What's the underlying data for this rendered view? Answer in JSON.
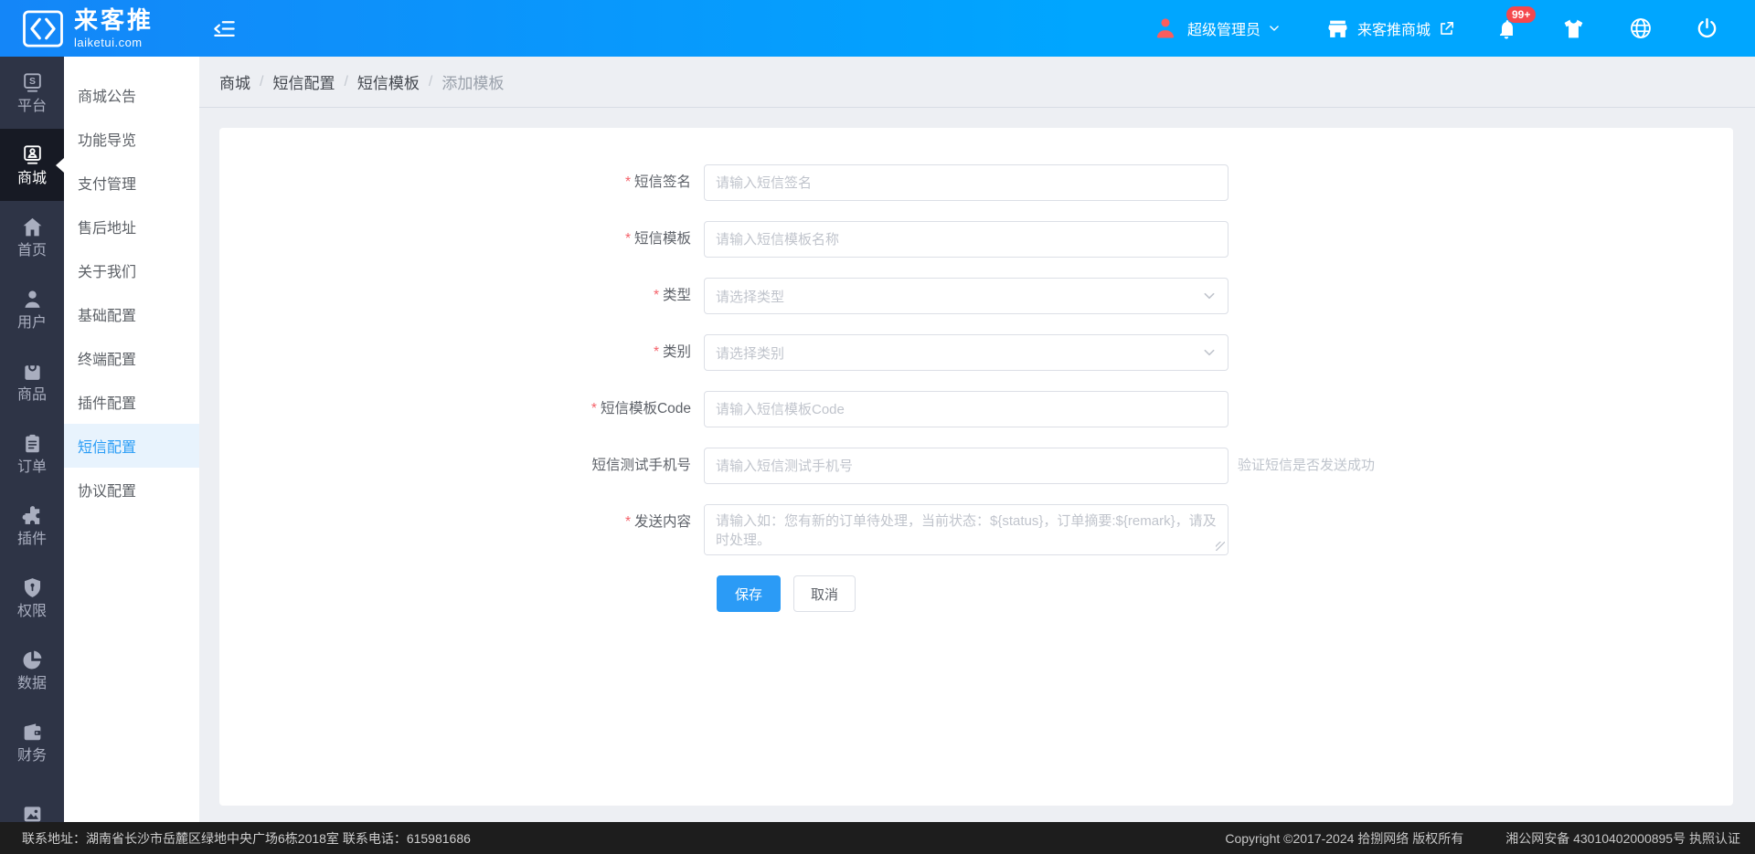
{
  "topbar": {
    "logo_title": "来客推",
    "logo_subtitle": "laiketui.com",
    "user_role": "超级管理员",
    "shop_link": "来客推商城",
    "notification_badge": "99+"
  },
  "rail": {
    "items": [
      {
        "name": "platform",
        "label": "平台",
        "icon": "platform-icon",
        "active": false
      },
      {
        "name": "mall",
        "label": "商城",
        "icon": "mall-icon",
        "active": true
      },
      {
        "name": "home",
        "label": "首页",
        "icon": "home-icon",
        "active": false
      },
      {
        "name": "user",
        "label": "用户",
        "icon": "user-icon",
        "active": false
      },
      {
        "name": "goods",
        "label": "商品",
        "icon": "goods-icon",
        "active": false
      },
      {
        "name": "order",
        "label": "订单",
        "icon": "order-icon",
        "active": false
      },
      {
        "name": "plugin",
        "label": "插件",
        "icon": "plugin-icon",
        "active": false
      },
      {
        "name": "permission",
        "label": "权限",
        "icon": "permission-icon",
        "active": false
      },
      {
        "name": "data",
        "label": "数据",
        "icon": "data-icon",
        "active": false
      },
      {
        "name": "finance",
        "label": "财务",
        "icon": "finance-icon",
        "active": false
      },
      {
        "name": "material",
        "label": "",
        "icon": "material-icon",
        "active": false
      }
    ]
  },
  "sidebar": {
    "items": [
      {
        "name": "notice",
        "label": "商城公告",
        "active": false
      },
      {
        "name": "guide",
        "label": "功能导览",
        "active": false
      },
      {
        "name": "payment",
        "label": "支付管理",
        "active": false
      },
      {
        "name": "aftersale",
        "label": "售后地址",
        "active": false
      },
      {
        "name": "about",
        "label": "关于我们",
        "active": false
      },
      {
        "name": "basic",
        "label": "基础配置",
        "active": false
      },
      {
        "name": "terminal",
        "label": "终端配置",
        "active": false
      },
      {
        "name": "plugin",
        "label": "插件配置",
        "active": false
      },
      {
        "name": "sms",
        "label": "短信配置",
        "active": true
      },
      {
        "name": "agreement",
        "label": "协议配置",
        "active": false
      }
    ]
  },
  "breadcrumb": {
    "separator": "/",
    "items": [
      "商城",
      "短信配置",
      "短信模板",
      "添加模板"
    ]
  },
  "form": {
    "fields": [
      {
        "name": "sms-signature",
        "label": "短信签名",
        "required": true,
        "type": "input",
        "placeholder": "请输入短信签名"
      },
      {
        "name": "sms-template",
        "label": "短信模板",
        "required": true,
        "type": "input",
        "placeholder": "请输入短信模板名称"
      },
      {
        "name": "type",
        "label": "类型",
        "required": true,
        "type": "select",
        "placeholder": "请选择类型"
      },
      {
        "name": "category",
        "label": "类别",
        "required": true,
        "type": "select",
        "placeholder": "请选择类别"
      },
      {
        "name": "sms-template-code",
        "label": "短信模板Code",
        "required": true,
        "type": "input",
        "placeholder": "请输入短信模板Code"
      },
      {
        "name": "sms-test-phone",
        "label": "短信测试手机号",
        "required": false,
        "type": "input",
        "placeholder": "请输入短信测试手机号",
        "hint": "验证短信是否发送成功"
      },
      {
        "name": "send-content",
        "label": "发送内容",
        "required": true,
        "type": "textarea",
        "placeholder": "请输入如：您有新的订单待处理，当前状态：${status}，订单摘要:${remark}，请及时处理。"
      }
    ],
    "save_label": "保存",
    "cancel_label": "取消"
  },
  "footer": {
    "contact": "联系地址：湖南省长沙市岳麓区绿地中央广场6栋2018室 联系电话：615981686",
    "copyright": "Copyright ©2017-2024 拾捌网络 版权所有",
    "license": "湘公网安备 43010402000895号 执照认证"
  },
  "colors": {
    "topbar_blue": "#00a6ff",
    "rail_bg": "#2e3446",
    "rail_active_bg": "#171a24",
    "menu_active_bg": "#e8f3fd",
    "menu_active_text": "#2a9df6",
    "primary_button": "#2b9bf6",
    "required_red": "#f5626a",
    "badge_red": "#f5484d",
    "footer_bg": "#1d1d1d"
  }
}
